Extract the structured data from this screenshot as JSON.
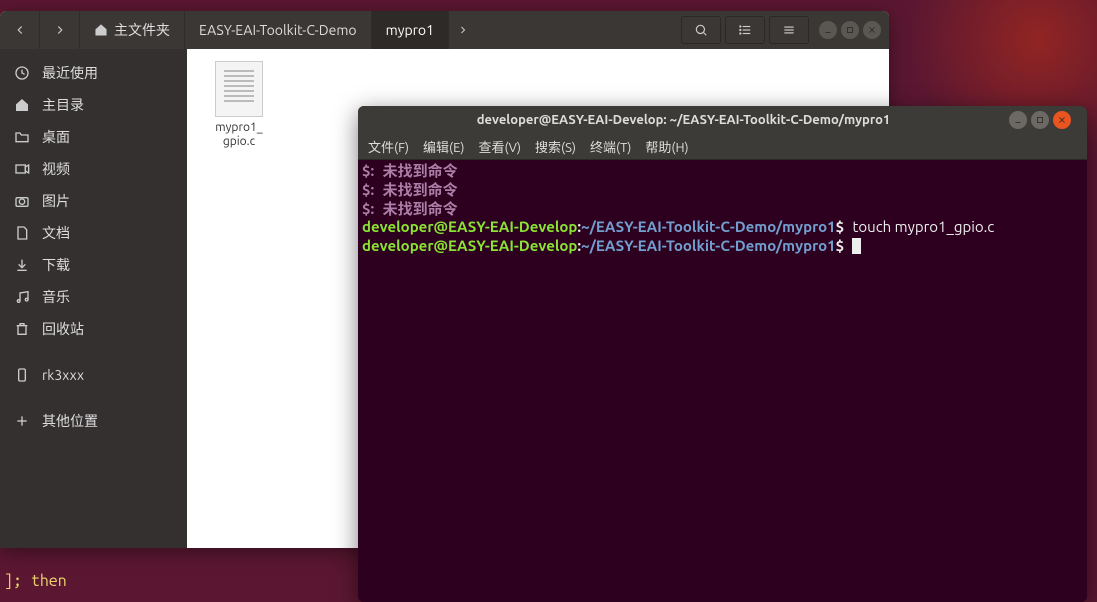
{
  "nautilus": {
    "breadcrumbs": {
      "home_label": "主文件夹",
      "crumb1": "EASY-EAI-Toolkit-C-Demo",
      "crumb2": "mypro1"
    },
    "sidebar": {
      "recent": "最近使用",
      "home": "主目录",
      "desktop": "桌面",
      "videos": "视频",
      "pictures": "图片",
      "documents": "文档",
      "downloads": "下载",
      "music": "音乐",
      "trash": "回收站",
      "device1": "rk3xxx",
      "other": "其他位置"
    },
    "content": {
      "file1_line1": "mypro1_",
      "file1_line2": "gpio.c"
    }
  },
  "terminal": {
    "title": "developer@EASY-EAI-Develop: ~/EASY-EAI-Toolkit-C-Demo/mypro1",
    "menus": {
      "file": "文件(F)",
      "edit": "编辑(E)",
      "view": "查看(V)",
      "search": "搜索(S)",
      "term": "终端(T)",
      "help": "帮助(H)"
    },
    "lines": {
      "err_prefix": "$:",
      "err_text": "未找到命令",
      "user": "developer@EASY-EAI-Develop",
      "path": "~/EASY-EAI-Toolkit-C-Demo/mypro1",
      "sigil": "$",
      "cmd1": "touch mypro1_gpio.c"
    }
  },
  "bottom": {
    "snippet": "]; then"
  }
}
